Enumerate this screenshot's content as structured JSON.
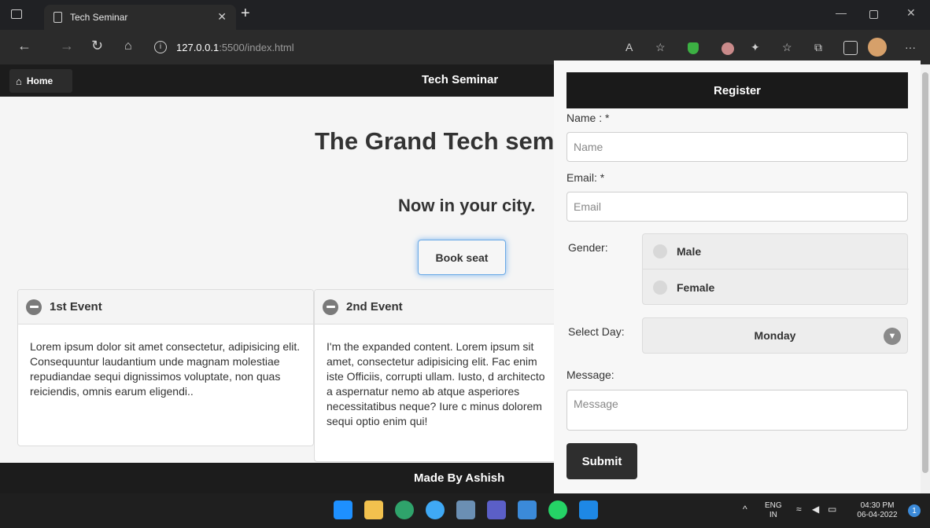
{
  "browser": {
    "tab_title": "Tech Seminar",
    "address_host": "127.0.0.1",
    "address_path": ":5500/index.html"
  },
  "page": {
    "home_label": "Home",
    "header_title": "Tech Seminar",
    "hero_title": "The Grand Tech sem",
    "subtitle": "Now in your city.",
    "book_label": "Book seat",
    "events": [
      {
        "title": "1st Event",
        "body": "Lorem ipsum dolor sit amet consectetur, adipisicing elit. Consequuntur laudantium unde magnam molestiae repudiandae sequi dignissimos voluptate, non quas reiciendis, omnis earum eligendi.."
      },
      {
        "title": "2nd Event",
        "body": "I'm the expanded content. Lorem ipsum sit amet, consectetur adipisicing elit. Fac enim iste Officiis, corrupti ullam. Iusto, d architecto a aspernatur nemo ab atque asperiores necessitatibus neque? Iure c minus dolorem sequi optio enim qui!"
      }
    ],
    "footer_text": "Made By Ashish"
  },
  "register": {
    "title": "Register",
    "name_label": "Name : *",
    "name_placeholder": "Name",
    "email_label": "Email: *",
    "email_placeholder": "Email",
    "gender_label": "Gender:",
    "gender_options": [
      "Male",
      "Female"
    ],
    "day_label": "Select Day:",
    "day_value": "Monday",
    "message_label": "Message:",
    "message_placeholder": "Message",
    "submit_label": "Submit"
  },
  "taskbar": {
    "lang": "ENG",
    "region": "IN",
    "time": "04:30 PM",
    "date": "06-04-2022",
    "notification_count": "1"
  }
}
